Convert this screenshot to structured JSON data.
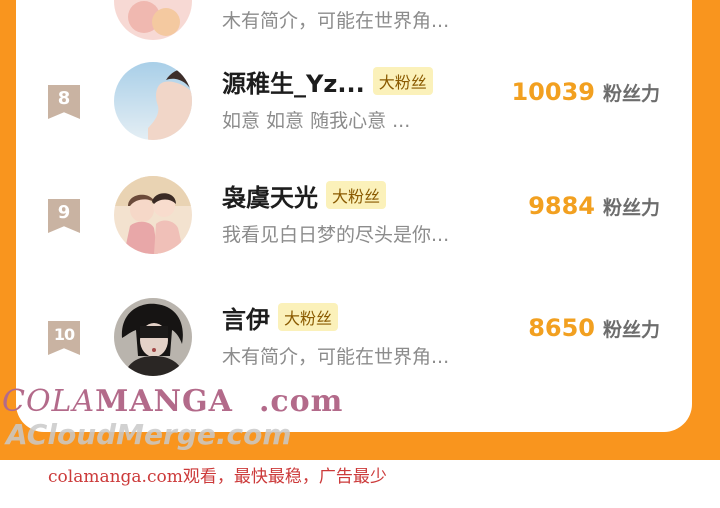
{
  "top_partial": {
    "bio": "木有简介，可能在世界角..."
  },
  "rows": [
    {
      "rank": "8",
      "name": "源稚生_Yz...",
      "badge": "大粉丝",
      "bio": "如意 如意 随我心意 ...",
      "score": "10039",
      "score_unit": "粉丝力",
      "avatar": "avatar-person-sky"
    },
    {
      "rank": "9",
      "name": "袅虞天光",
      "badge": "大粉丝",
      "bio": "我看见白日梦的尽头是你...",
      "score": "9884",
      "score_unit": "粉丝力",
      "avatar": "avatar-couple-illustration"
    },
    {
      "rank": "10",
      "name": "言伊",
      "badge": "大粉丝",
      "bio": "木有简介，可能在世界角...",
      "score": "8650",
      "score_unit": "粉丝力",
      "avatar": "avatar-dark-hair"
    }
  ],
  "watermark": {
    "line1_a": "COLA",
    "line1_b": "MANGA",
    "line1_c": ".com",
    "line2": "ACloudMerge.com"
  },
  "footer": {
    "note": "colamanga.com观看，最快最稳，广告最少"
  },
  "colors": {
    "frame": "#f9951e",
    "score": "#f2a020",
    "badge_bg": "#fbf1ba",
    "rank_badge": "#c9b3a2"
  }
}
